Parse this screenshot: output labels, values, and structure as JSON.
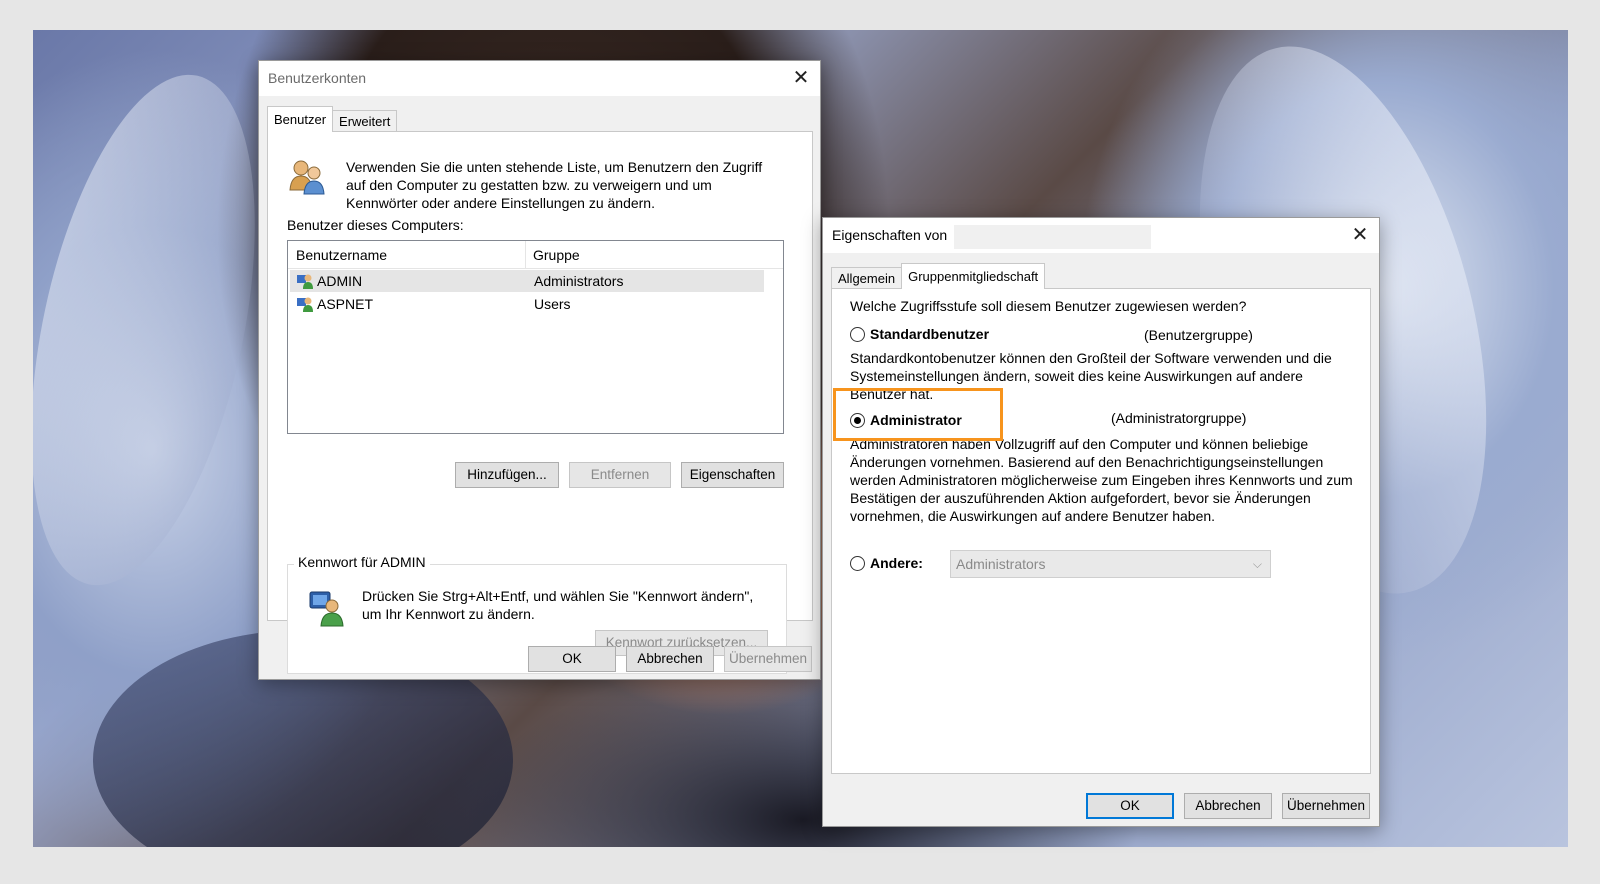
{
  "user_accounts": {
    "title": "Benutzerkonten",
    "tabs": [
      "Benutzer",
      "Erweitert"
    ],
    "intro": "Verwenden Sie die unten stehende Liste, um Benutzern den Zugriff auf den Computer zu gestatten bzw. zu verweigern und um Kennwörter oder andere Einstellungen zu ändern.",
    "users_label": "Benutzer dieses Computers:",
    "columns": [
      "Benutzername",
      "Gruppe"
    ],
    "rows": [
      {
        "name": "ADMIN",
        "group": "Administrators"
      },
      {
        "name": "ASPNET",
        "group": "Users"
      }
    ],
    "buttons": {
      "add": "Hinzufügen...",
      "remove": "Entfernen",
      "properties": "Eigenschaften"
    },
    "password_group": {
      "legend": "Kennwort für ADMIN",
      "text": "Drücken Sie Strg+Alt+Entf, und wählen Sie \"Kennwort ändern\", um Ihr Kennwort zu ändern.",
      "reset": "Kennwort zurücksetzen..."
    },
    "footer": {
      "ok": "OK",
      "cancel": "Abbrechen",
      "apply": "Übernehmen"
    }
  },
  "properties": {
    "title": "Eigenschaften von",
    "tabs": [
      "Allgemein",
      "Gruppenmitgliedschaft"
    ],
    "question": "Welche Zugriffsstufe soll diesem Benutzer zugewiesen werden?",
    "options": [
      {
        "label": "Standardbenutzer",
        "group": "(Benutzergruppe)",
        "selected": false,
        "desc": "Standardkontobenutzer können den Großteil der Software verwenden und die Systemeinstellungen ändern, soweit dies keine Auswirkungen auf andere Benutzer hat."
      },
      {
        "label": "Administrator",
        "group": "(Administratorgruppe)",
        "selected": true,
        "desc": "Administratoren haben Vollzugriff auf den Computer und können beliebige Änderungen vornehmen. Basierend auf den Benachrichtigungseinstellungen werden Administratoren möglicherweise zum Eingeben ihres Kennworts und zum Bestätigen der auszuführenden Aktion aufgefordert, bevor sie Änderungen vornehmen, die Auswirkungen auf andere Benutzer haben."
      },
      {
        "label": "Andere:",
        "selected": false
      }
    ],
    "other_select_value": "Administrators",
    "footer": {
      "ok": "OK",
      "cancel": "Abbrechen",
      "apply": "Übernehmen"
    }
  },
  "colors": {
    "highlight": "#f7941d",
    "default_button": "#0078d7"
  }
}
